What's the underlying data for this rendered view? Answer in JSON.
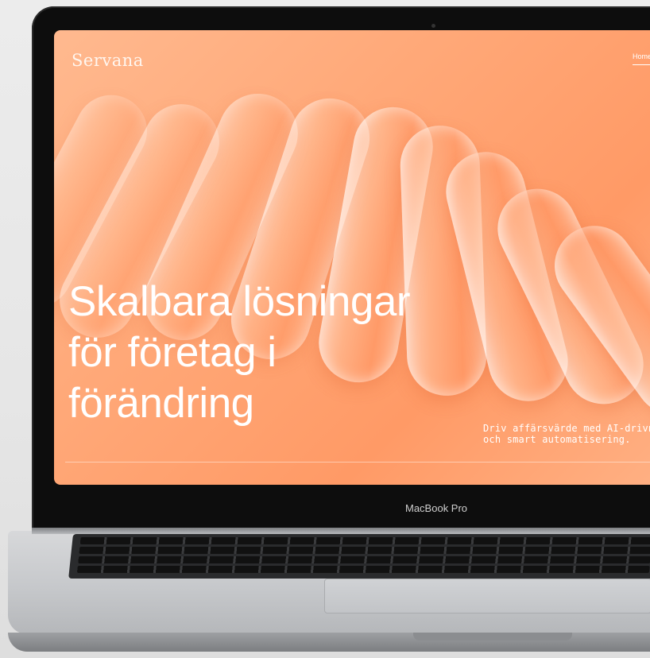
{
  "site": {
    "logo": "Servana",
    "nav": {
      "home_label": "Home"
    }
  },
  "hero": {
    "headline_lines": [
      "Skalbara lösningar",
      "för företag i",
      "förändring"
    ],
    "subtext_lines": [
      "Driv affärsvärde med AI-drivna",
      "och smart automatisering."
    ]
  },
  "device": {
    "brand_label": "MacBook Pro"
  },
  "colors": {
    "hero_background": "#ffa979",
    "hero_text": "#ffffff",
    "bezel": "#0d0d0d",
    "aluminum": "#c6c8cb"
  }
}
